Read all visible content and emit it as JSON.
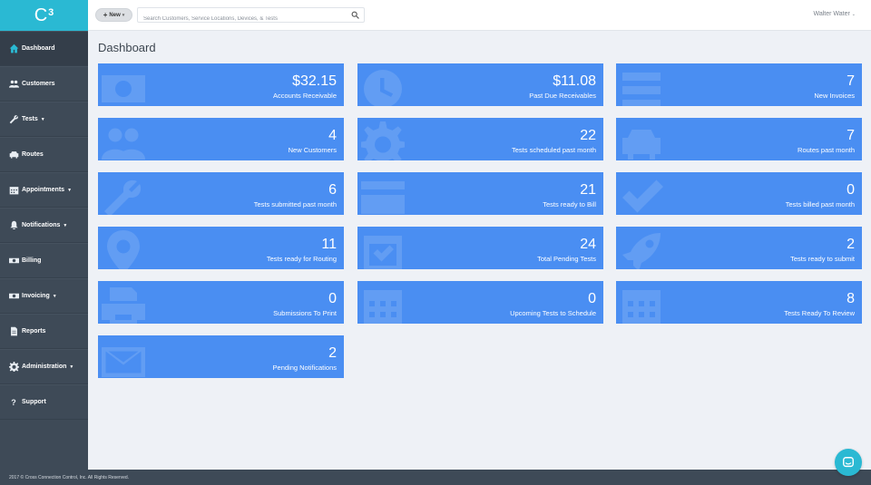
{
  "app": {
    "logo_text": "C",
    "logo_sup": "3"
  },
  "header": {
    "new_label": "New",
    "search_placeholder": "Search Customers, Service Locations, Devices, & Tests",
    "user_name": "Walter Water"
  },
  "sidebar": {
    "items": [
      {
        "label": "Dashboard",
        "icon": "home-icon",
        "active": true
      },
      {
        "label": "Customers",
        "icon": "users-icon"
      },
      {
        "label": "Tests",
        "icon": "wrench-icon",
        "dropdown": true
      },
      {
        "label": "Routes",
        "icon": "car-icon"
      },
      {
        "label": "Appointments",
        "icon": "calendar-icon",
        "dropdown": true
      },
      {
        "label": "Notifications",
        "icon": "bell-icon",
        "dropdown": true
      },
      {
        "label": "Billing",
        "icon": "money-icon"
      },
      {
        "label": "Invoicing",
        "icon": "money-icon",
        "dropdown": true
      },
      {
        "label": "Reports",
        "icon": "file-icon"
      },
      {
        "label": "Administration",
        "icon": "cog-icon",
        "dropdown": true
      },
      {
        "label": "Support",
        "icon": "question-icon"
      }
    ]
  },
  "main": {
    "title": "Dashboard",
    "tiles": [
      {
        "value": "$32.15",
        "label": "Accounts Receivable",
        "icon": "money-icon"
      },
      {
        "value": "$11.08",
        "label": "Past Due Receivables",
        "icon": "clock-icon"
      },
      {
        "value": "7",
        "label": "New Invoices",
        "icon": "list-icon"
      },
      {
        "value": "4",
        "label": "New Customers",
        "icon": "users-icon"
      },
      {
        "value": "22",
        "label": "Tests scheduled past month",
        "icon": "cog-icon"
      },
      {
        "value": "7",
        "label": "Routes past month",
        "icon": "car-icon"
      },
      {
        "value": "6",
        "label": "Tests submitted past month",
        "icon": "wrench-icon"
      },
      {
        "value": "21",
        "label": "Tests ready to Bill",
        "icon": "credit-card-icon"
      },
      {
        "value": "0",
        "label": "Tests billed past month",
        "icon": "check-icon"
      },
      {
        "value": "11",
        "label": "Tests ready for Routing",
        "icon": "map-marker-icon"
      },
      {
        "value": "24",
        "label": "Total Pending Tests",
        "icon": "calendar-check-icon"
      },
      {
        "value": "2",
        "label": "Tests ready to submit",
        "icon": "rocket-icon"
      },
      {
        "value": "0",
        "label": "Submissions To Print",
        "icon": "print-icon"
      },
      {
        "value": "0",
        "label": "Upcoming Tests to Schedule",
        "icon": "calendar-icon"
      },
      {
        "value": "8",
        "label": "Tests Ready To Review",
        "icon": "calendar-icon"
      },
      {
        "value": "2",
        "label": "Pending Notifications",
        "icon": "envelope-icon"
      }
    ]
  },
  "footer": {
    "text": "2017 © Cross Connection Control, Inc.  All Rights Reserved."
  },
  "colors": {
    "accent": "#2ab9d3",
    "tile": "#4a8ef2",
    "sidebar": "#3e4a57"
  }
}
